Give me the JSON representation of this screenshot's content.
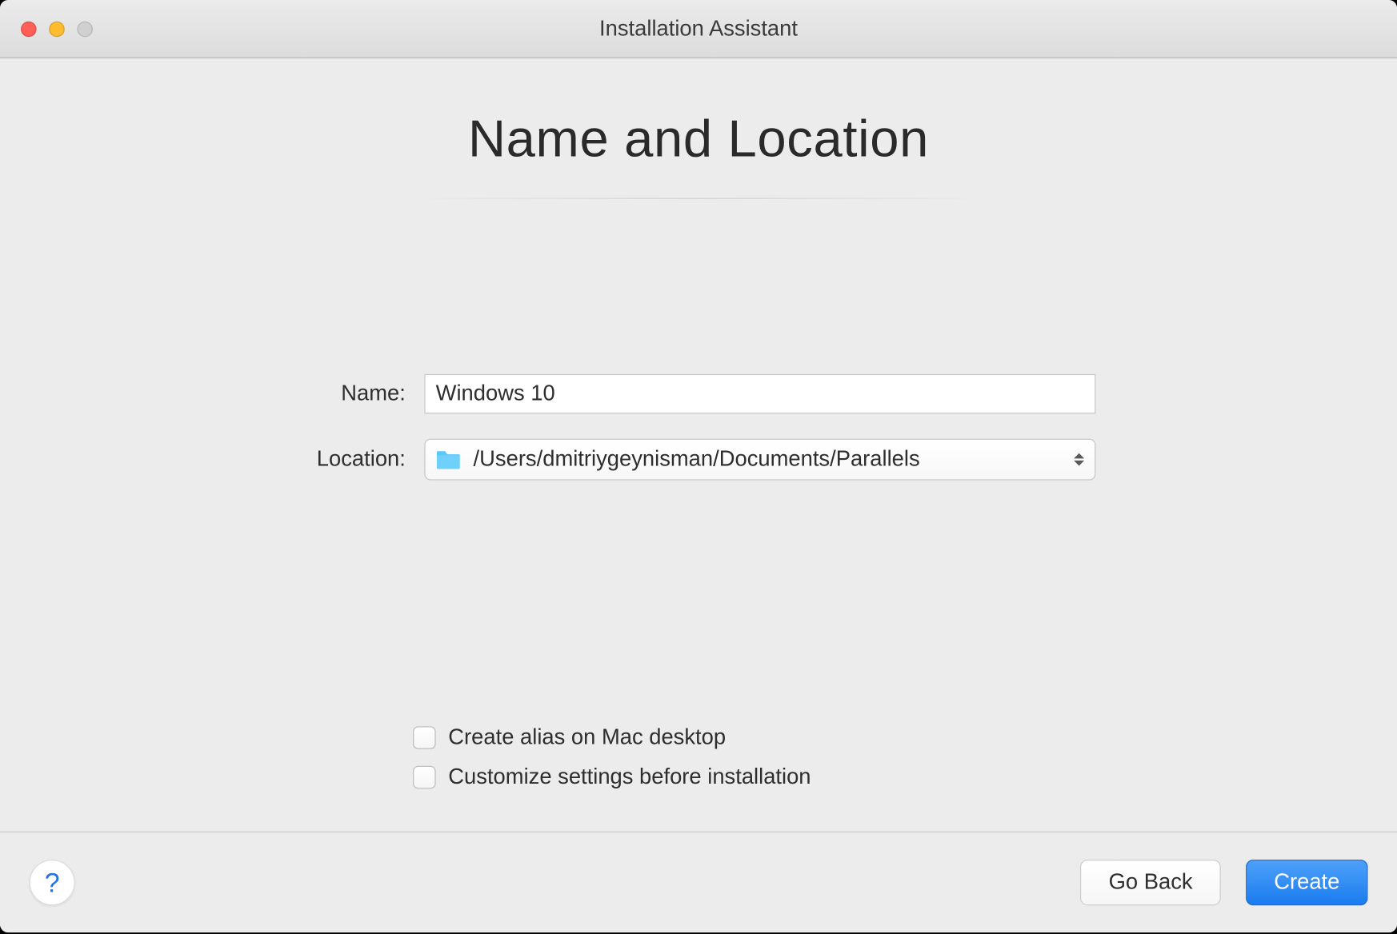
{
  "window": {
    "title": "Installation Assistant"
  },
  "heading": "Name and Location",
  "form": {
    "name_label": "Name:",
    "name_value": "Windows 10",
    "location_label": "Location:",
    "location_value": "/Users/dmitriygeynisman/Documents/Parallels"
  },
  "checkboxes": {
    "alias_label": "Create alias on Mac desktop",
    "customize_label": "Customize settings before installation"
  },
  "footer": {
    "help_symbol": "?",
    "back_label": "Go Back",
    "create_label": "Create"
  },
  "colors": {
    "primary": "#1a7cf0",
    "folder": "#5ac8fa"
  }
}
